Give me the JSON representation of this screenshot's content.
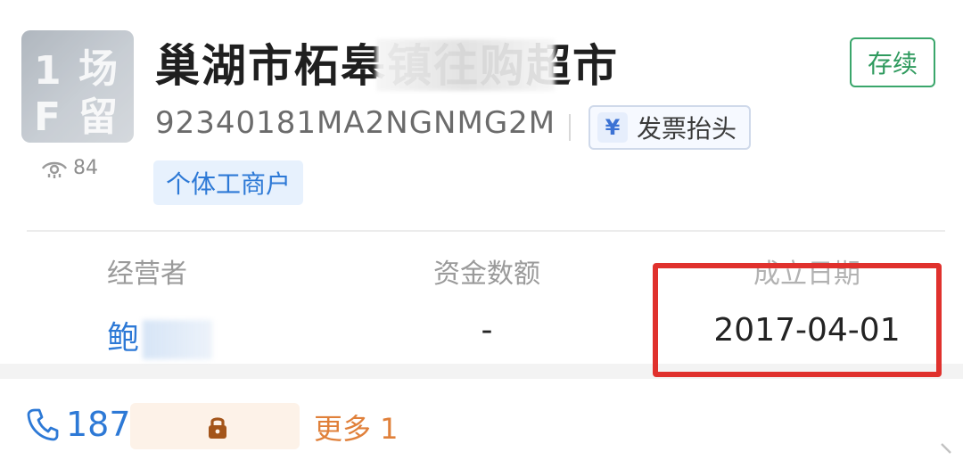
{
  "company": {
    "name": "巢湖市柘皋镇往",
    "name_tail": "购超市",
    "status": "存续",
    "credit_code": "92340181MA2NGNMG2M",
    "invoice_label": "发票抬头",
    "invoice_symbol": "¥",
    "tag": "个体工商户",
    "views": "84"
  },
  "logo_text": [
    "1",
    "场",
    "F",
    "留"
  ],
  "info": {
    "operator_label": "经营者",
    "operator_value": "鲍",
    "capital_label": "资金数额",
    "capital_value": "-",
    "date_label": "成立日期",
    "date_value": "2017-04-01"
  },
  "contact": {
    "phone_prefix": "187",
    "more_label": "更多 1"
  },
  "colors": {
    "status_green": "#2f9a5e",
    "link_blue": "#2d79d6",
    "highlight_red": "#e0312d",
    "more_orange": "#e0803a"
  }
}
